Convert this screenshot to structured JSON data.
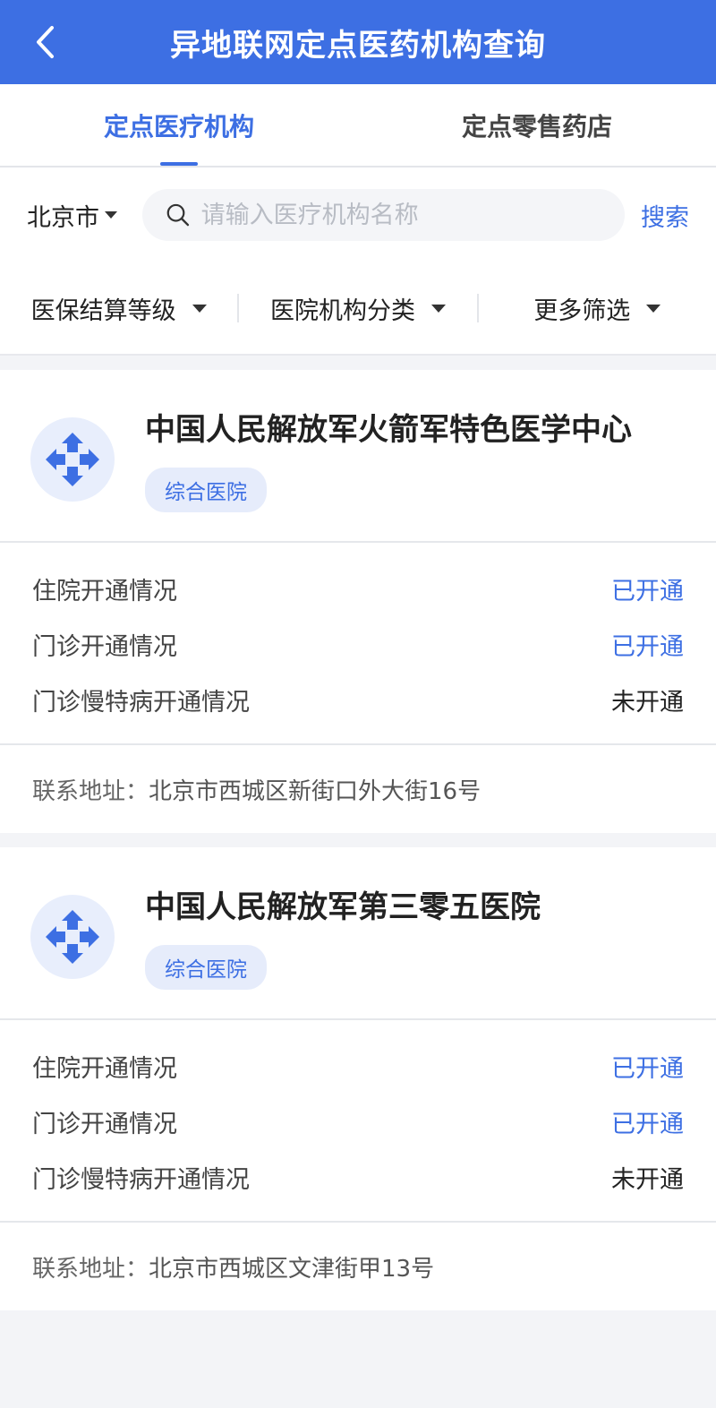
{
  "header": {
    "title": "异地联网定点医药机构查询"
  },
  "tabs": [
    {
      "label": "定点医疗机构",
      "active": true
    },
    {
      "label": "定点零售药店",
      "active": false
    }
  ],
  "search": {
    "city": "北京市",
    "placeholder": "请输入医疗机构名称",
    "value": "",
    "button_label": "搜索"
  },
  "filters": [
    {
      "label": "医保结算等级"
    },
    {
      "label": "医院机构分类"
    },
    {
      "label": "更多筛选"
    }
  ],
  "colors": {
    "accent": "#3d6fe3",
    "badge_bg": "#e6ecfb"
  },
  "institutions": [
    {
      "name": "中国人民解放军火箭军特色医学中心",
      "category": "综合医院",
      "status": [
        {
          "label": "住院开通情况",
          "value": "已开通",
          "open": true
        },
        {
          "label": "门诊开通情况",
          "value": "已开通",
          "open": true
        },
        {
          "label": "门诊慢特病开通情况",
          "value": "未开通",
          "open": false
        }
      ],
      "address_label": "联系地址：",
      "address": "北京市西城区新街口外大街16号"
    },
    {
      "name": "中国人民解放军第三零五医院",
      "category": "综合医院",
      "status": [
        {
          "label": "住院开通情况",
          "value": "已开通",
          "open": true
        },
        {
          "label": "门诊开通情况",
          "value": "已开通",
          "open": true
        },
        {
          "label": "门诊慢特病开通情况",
          "value": "未开通",
          "open": false
        }
      ],
      "address_label": "联系地址：",
      "address": "北京市西城区文津街甲13号"
    }
  ]
}
